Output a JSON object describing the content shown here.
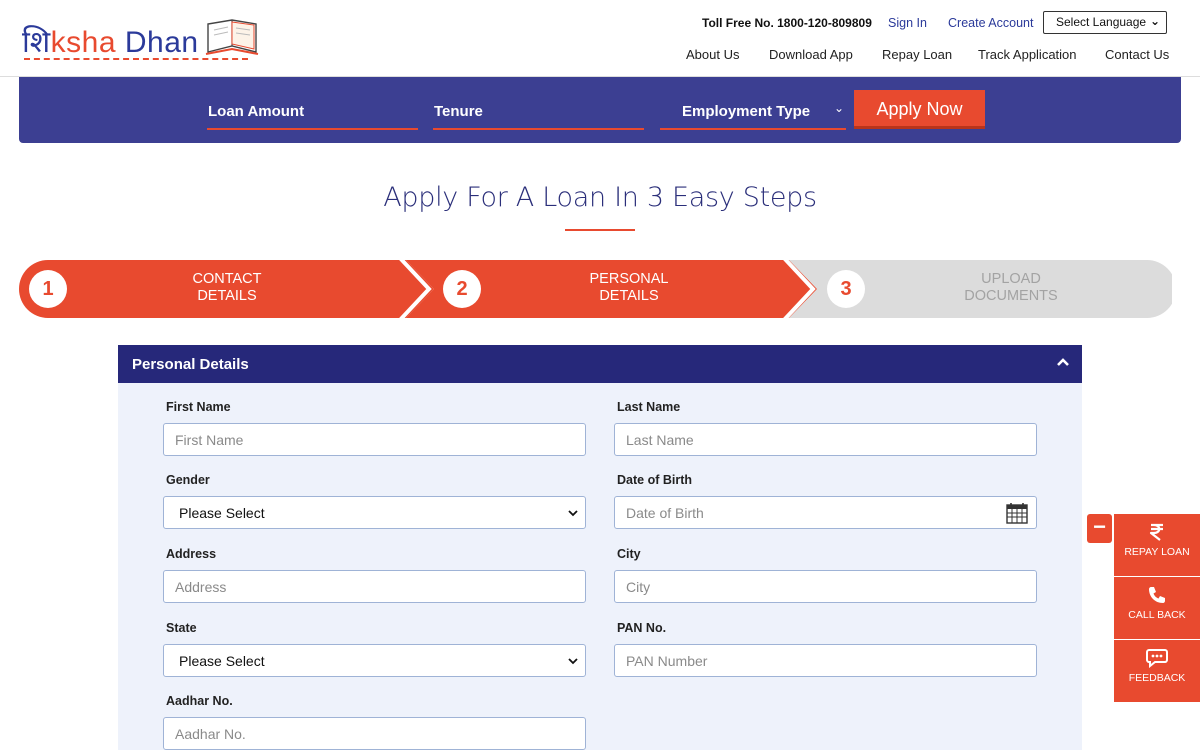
{
  "brand": {
    "logo_devanagari": "शि",
    "logo_rest": "ksha",
    "logo_dhan": " Dhan"
  },
  "header": {
    "toll_free": "Toll Free No. 1800-120-809809",
    "sign_in": "Sign In",
    "create_account": "Create Account",
    "language_select": "Select Language",
    "nav": [
      "About Us",
      "Download App",
      "Repay Loan",
      "Track Application",
      "Contact Us"
    ]
  },
  "loan_bar": {
    "loan_amount": "Loan Amount",
    "tenure": "Tenure",
    "employment_type": "Employment Type",
    "apply_now": "Apply Now"
  },
  "page_title": "Apply For A Loan In 3 Easy Steps",
  "steps": [
    {
      "number": "1",
      "line1": "CONTACT",
      "line2": "DETAILS",
      "active": true
    },
    {
      "number": "2",
      "line1": "PERSONAL",
      "line2": "DETAILS",
      "active": true
    },
    {
      "number": "3",
      "line1": "UPLOAD",
      "line2": "DOCUMENTS",
      "active": false
    }
  ],
  "form": {
    "panel_title": "Personal Details",
    "first_name": {
      "label": "First Name",
      "placeholder": "First Name"
    },
    "last_name": {
      "label": "Last Name",
      "placeholder": "Last Name"
    },
    "gender": {
      "label": "Gender",
      "value": "Please Select"
    },
    "dob": {
      "label": "Date of Birth",
      "placeholder": "Date of Birth"
    },
    "address": {
      "label": "Address",
      "placeholder": "Address"
    },
    "city": {
      "label": "City",
      "placeholder": "City"
    },
    "state": {
      "label": "State",
      "value": "Please Select"
    },
    "pan": {
      "label": "PAN No.",
      "placeholder": "PAN Number"
    },
    "aadhar": {
      "label": "Aadhar No.",
      "placeholder": "Aadhar No."
    }
  },
  "side_widget": {
    "collapse": "−",
    "buttons": [
      {
        "label": "REPAY LOAN",
        "icon": "rupee-icon"
      },
      {
        "label": "CALL BACK",
        "icon": "phone-icon"
      },
      {
        "label": "FEEDBACK",
        "icon": "chat-icon"
      }
    ]
  },
  "colors": {
    "brand_blue": "#2b3a9a",
    "accent_orange": "#e84a2f",
    "panel_navy": "#26287a",
    "loanbar_blue": "#3c3f92"
  }
}
